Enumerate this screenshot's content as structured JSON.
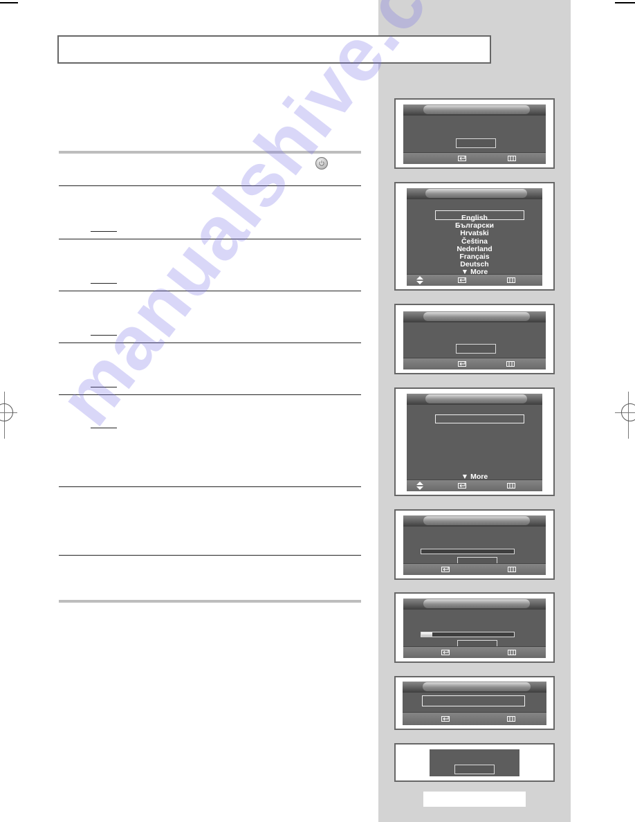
{
  "page": {
    "title": "",
    "page_number": "",
    "watermark": "manualshive.com"
  },
  "steps": {
    "count": 8,
    "power_button_icon": "power-icon"
  },
  "osd_screens": [
    {
      "id": 1,
      "type": "confirm",
      "footer_icons": [
        "enter-icon",
        "exit-icon"
      ]
    },
    {
      "id": 2,
      "type": "language-list",
      "languages": [
        "English",
        "Български",
        "Hrvatski",
        "Čeština",
        "Nederland",
        "Français",
        "Deutsch"
      ],
      "selected": "English",
      "more_label": "▼ More",
      "footer_icons": [
        "updown-icon",
        "enter-icon",
        "exit-icon"
      ]
    },
    {
      "id": 3,
      "type": "confirm",
      "footer_icons": [
        "enter-icon",
        "exit-icon"
      ]
    },
    {
      "id": 4,
      "type": "list",
      "more_label": "▼ More",
      "footer_icons": [
        "updown-icon",
        "enter-icon",
        "exit-icon"
      ]
    },
    {
      "id": 5,
      "type": "progress",
      "progress_percent": 0,
      "footer_icons": [
        "enter-icon",
        "exit-icon"
      ]
    },
    {
      "id": 6,
      "type": "progress",
      "progress_percent": 12,
      "footer_icons": [
        "enter-icon",
        "exit-icon"
      ]
    },
    {
      "id": 7,
      "type": "message",
      "footer_icons": [
        "enter-icon",
        "exit-icon"
      ]
    },
    {
      "id": 8,
      "type": "popup"
    }
  ]
}
